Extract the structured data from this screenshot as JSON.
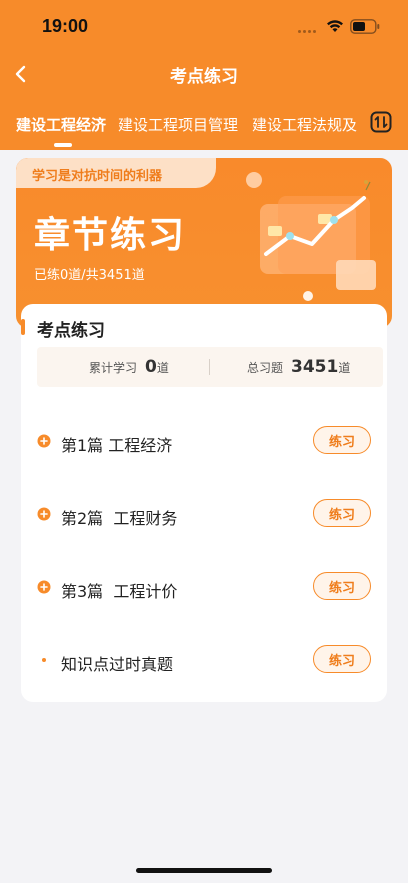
{
  "status_bar": {
    "time": "19:00"
  },
  "nav": {
    "title": "考点练习",
    "back_icon": "chevron-left-icon"
  },
  "tabs": [
    {
      "label": "建设工程经济",
      "active": true
    },
    {
      "label": "建设工程项目管理",
      "active": false
    },
    {
      "label": "建设工程法规及",
      "active": false
    }
  ],
  "tab_filter_icon": "filter-switch-icon",
  "banner": {
    "tag": "学习是对抗时间的利器",
    "title": "章节练习",
    "progress_text": "已练0道/共3451道"
  },
  "section": {
    "title": "考点练习",
    "stats": {
      "studied_label": "累计学习",
      "studied_value": "0",
      "studied_unit": "道",
      "total_label": "总习题",
      "total_value": "3451",
      "total_unit": "道"
    },
    "items": [
      {
        "label": "第1篇 工程经济",
        "button": "练习",
        "icon": "plus-circle-icon"
      },
      {
        "label": "第2篇  工程财务",
        "button": "练习",
        "icon": "plus-circle-icon"
      },
      {
        "label": "第3篇  工程计价",
        "button": "练习",
        "icon": "plus-circle-icon"
      },
      {
        "label": "知识点过时真题",
        "button": "练习",
        "icon": "dot-icon"
      }
    ]
  },
  "colors": {
    "accent": "#f78b2a",
    "background": "#f3f3f6"
  }
}
